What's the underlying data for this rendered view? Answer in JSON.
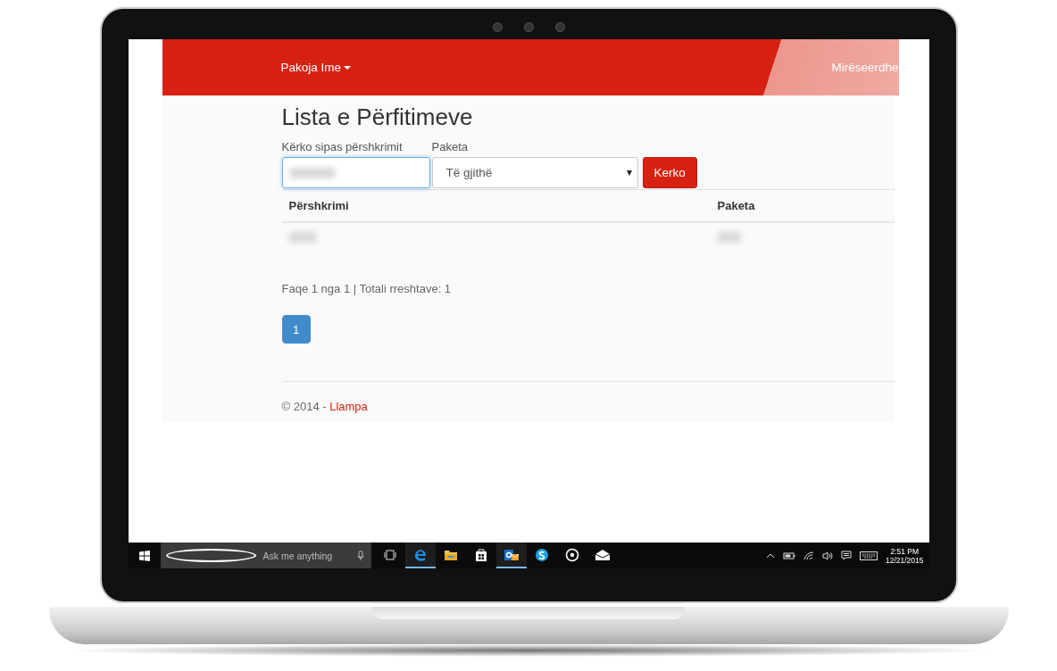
{
  "navbar": {
    "menu": {
      "label": "Pakoja Ime"
    },
    "greeting": "Mirëseerdhe"
  },
  "page": {
    "title": "Lista e Përfitimeve",
    "search": {
      "label": "Kërko sipas përshkrimit"
    },
    "package_filter": {
      "label": "Paketa",
      "value": "Të gjithë"
    },
    "search_button": "Kerko"
  },
  "table": {
    "columns": [
      "Përshkrimi",
      "Paketa"
    ]
  },
  "pager_info": "Faqe 1 nga 1 | Totali rreshtave: 1",
  "pagination": [
    {
      "label": "1",
      "selected": true
    }
  ],
  "footer": {
    "text": "© 2014 - ",
    "link": "Llampa"
  },
  "taskbar": {
    "search": {
      "placeholder": "Ask me anything"
    },
    "apps": [
      {
        "kind": "task-view",
        "running": false
      },
      {
        "kind": "browser",
        "running": true
      },
      {
        "kind": "folder",
        "running": false
      },
      {
        "kind": "store",
        "running": false
      },
      {
        "kind": "mail-app",
        "running": true
      },
      {
        "kind": "chat",
        "running": false
      },
      {
        "kind": "music",
        "running": false
      },
      {
        "kind": "envelope",
        "running": false
      }
    ],
    "time": "2:51 PM",
    "date": "12/21/2015"
  }
}
